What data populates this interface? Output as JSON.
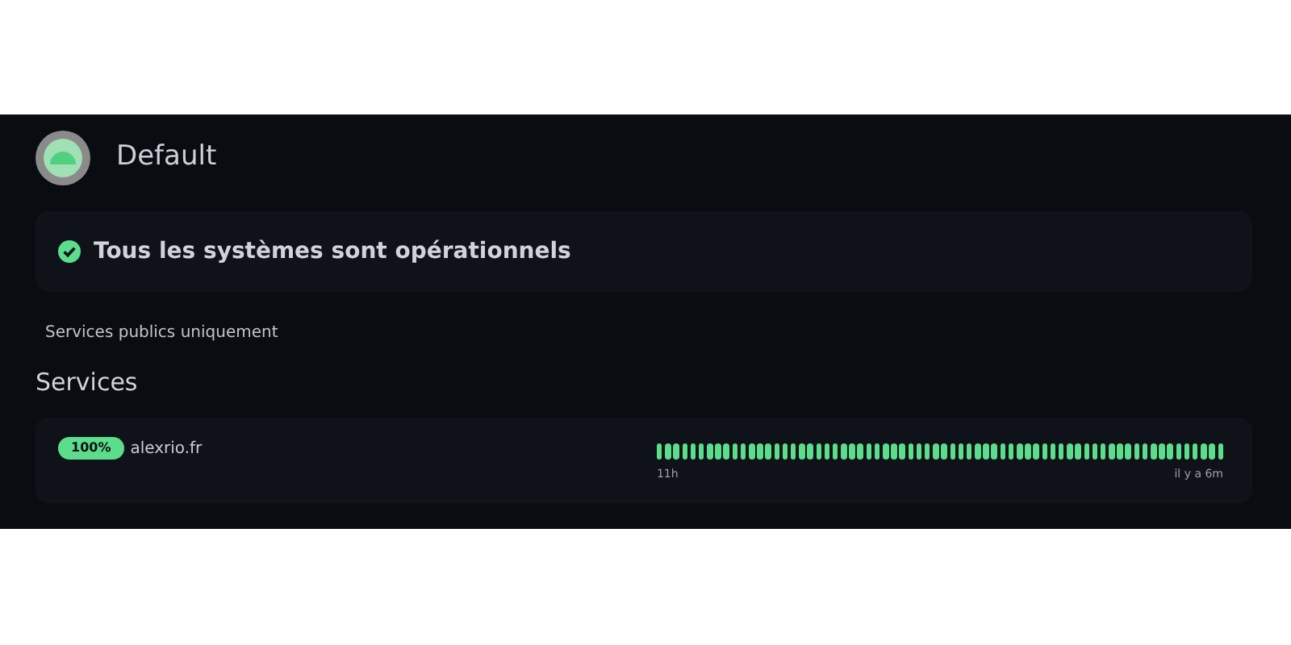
{
  "header": {
    "title": "Default"
  },
  "overall": {
    "up": true,
    "text": "Tous les systèmes sont opérationnels"
  },
  "filter_note": "Services publics uniquement",
  "section_title": "Services",
  "services": [
    {
      "uptime": "100%",
      "name": "alexrio.fr",
      "start_label": "11h",
      "end_label": "il y a 6m",
      "beats": [
        {
          "up": true
        },
        {
          "up": true
        },
        {
          "up": true
        },
        {
          "up": true
        },
        {
          "up": true
        },
        {
          "up": true
        },
        {
          "up": true
        },
        {
          "up": true
        },
        {
          "up": true
        },
        {
          "up": true
        },
        {
          "up": true
        },
        {
          "up": true
        },
        {
          "up": true
        },
        {
          "up": true
        },
        {
          "up": true
        },
        {
          "up": true
        },
        {
          "up": true
        },
        {
          "up": true
        },
        {
          "up": true
        },
        {
          "up": true
        },
        {
          "up": true
        },
        {
          "up": true
        },
        {
          "up": true
        },
        {
          "up": true
        },
        {
          "up": true
        },
        {
          "up": true
        },
        {
          "up": true
        },
        {
          "up": true
        },
        {
          "up": true
        },
        {
          "up": true
        },
        {
          "up": true
        },
        {
          "up": true
        },
        {
          "up": true
        },
        {
          "up": true
        },
        {
          "up": true
        },
        {
          "up": true
        },
        {
          "up": true
        },
        {
          "up": true
        },
        {
          "up": true
        },
        {
          "up": true
        },
        {
          "up": true
        },
        {
          "up": true
        },
        {
          "up": true
        },
        {
          "up": true
        },
        {
          "up": true
        },
        {
          "up": true
        },
        {
          "up": true
        },
        {
          "up": true
        },
        {
          "up": true
        },
        {
          "up": true
        },
        {
          "up": true
        },
        {
          "up": true
        },
        {
          "up": true
        },
        {
          "up": true
        },
        {
          "up": true
        },
        {
          "up": true
        },
        {
          "up": true
        },
        {
          "up": true
        },
        {
          "up": true
        },
        {
          "up": true
        },
        {
          "up": true
        },
        {
          "up": true
        },
        {
          "up": true
        },
        {
          "up": true
        },
        {
          "up": true
        },
        {
          "up": true
        },
        {
          "up": true
        },
        {
          "up": true
        }
      ]
    }
  ]
}
